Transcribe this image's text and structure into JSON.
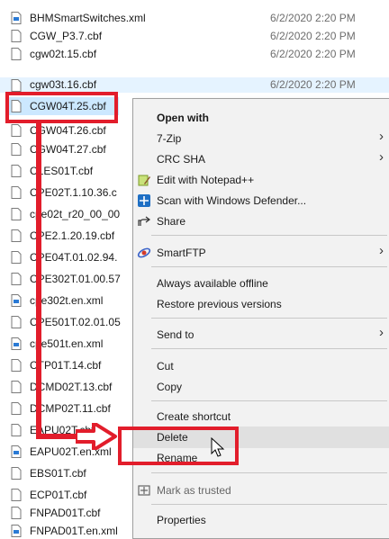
{
  "files": [
    {
      "name": "BHMSmartSwitches.xml",
      "date": "6/2/2020 2:20 PM",
      "icon": "xml-file-icon"
    },
    {
      "name": "CGW_P3.7.cbf",
      "date": "6/2/2020 2:20 PM",
      "icon": "file-icon"
    },
    {
      "name": "cgw02t.15.cbf",
      "date": "6/2/2020 2:20 PM",
      "icon": "file-icon"
    },
    {
      "name": "cgw03t.16.cbf",
      "date": "6/2/2020 2:20 PM",
      "icon": "file-icon"
    },
    {
      "name": "CGW04T.25.cbf",
      "date": "",
      "icon": "file-icon"
    },
    {
      "name": "CGW04T.26.cbf",
      "date": "",
      "icon": "file-icon"
    },
    {
      "name": "CGW04T.27.cbf",
      "date": "",
      "icon": "file-icon"
    },
    {
      "name": "CLES01T.cbf",
      "date": "",
      "icon": "file-icon"
    },
    {
      "name": "CPE02T.1.10.36.c",
      "date": "",
      "icon": "file-icon"
    },
    {
      "name": "cpe02t_r20_00_00",
      "date": "",
      "icon": "file-icon"
    },
    {
      "name": "CPE2.1.20.19.cbf",
      "date": "",
      "icon": "file-icon"
    },
    {
      "name": "CPE04T.01.02.94.",
      "date": "",
      "icon": "file-icon"
    },
    {
      "name": "CPE302T.01.00.57",
      "date": "",
      "icon": "file-icon"
    },
    {
      "name": "cpe302t.en.xml",
      "date": "",
      "icon": "xml-file-icon"
    },
    {
      "name": "CPE501T.02.01.05",
      "date": "",
      "icon": "file-icon"
    },
    {
      "name": "cpe501t.en.xml",
      "date": "",
      "icon": "xml-file-icon"
    },
    {
      "name": "CTP01T.14.cbf",
      "date": "",
      "icon": "file-icon"
    },
    {
      "name": "DCMD02T.13.cbf",
      "date": "",
      "icon": "file-icon"
    },
    {
      "name": "DCMP02T.11.cbf",
      "date": "",
      "icon": "file-icon"
    },
    {
      "name": "EAPU02T.cbf",
      "date": "",
      "icon": "file-icon"
    },
    {
      "name": "EAPU02T.en.xml",
      "date": "",
      "icon": "xml-file-icon"
    },
    {
      "name": "EBS01T.cbf",
      "date": "",
      "icon": "file-icon"
    },
    {
      "name": "ECP01T.cbf",
      "date": "",
      "icon": "file-icon"
    },
    {
      "name": "FNPAD01T.cbf",
      "date": "",
      "icon": "file-icon"
    },
    {
      "name": "FNPAD01T.en.xml",
      "date": "",
      "icon": "xml-file-icon"
    }
  ],
  "selected_file": "CGW04T.25.cbf",
  "context_menu": {
    "items": [
      {
        "label": "Open with",
        "bold": true,
        "icon": "",
        "submenu": false
      },
      {
        "label": "7-Zip",
        "icon": "",
        "submenu": true
      },
      {
        "label": "CRC SHA",
        "icon": "",
        "submenu": true
      },
      {
        "label": "Edit with Notepad++",
        "icon": "notepad-plus-plus-icon",
        "submenu": false
      },
      {
        "label": "Scan with Windows Defender...",
        "icon": "windows-defender-icon",
        "submenu": false
      },
      {
        "label": "Share",
        "icon": "share-icon",
        "submenu": false
      },
      {
        "label": "SmartFTP",
        "icon": "smartftp-icon",
        "submenu": true
      },
      {
        "label": "Always available offline",
        "icon": "",
        "submenu": false
      },
      {
        "label": "Restore previous versions",
        "icon": "",
        "submenu": false
      },
      {
        "label": "Send to",
        "icon": "",
        "submenu": true
      },
      {
        "label": "Cut",
        "icon": "",
        "submenu": false
      },
      {
        "label": "Copy",
        "icon": "",
        "submenu": false
      },
      {
        "label": "Create shortcut",
        "icon": "",
        "submenu": false
      },
      {
        "label": "Delete",
        "icon": "",
        "submenu": false,
        "highlighted": true
      },
      {
        "label": "Rename",
        "icon": "",
        "submenu": false
      },
      {
        "label": "Mark as trusted",
        "icon": "shield-icon",
        "submenu": false
      },
      {
        "label": "Properties",
        "icon": "",
        "submenu": false
      }
    ]
  },
  "colors": {
    "annotation_red": "#e21d2b",
    "selection_blue": "#cce8ff",
    "menu_background": "#f2f2f2"
  }
}
